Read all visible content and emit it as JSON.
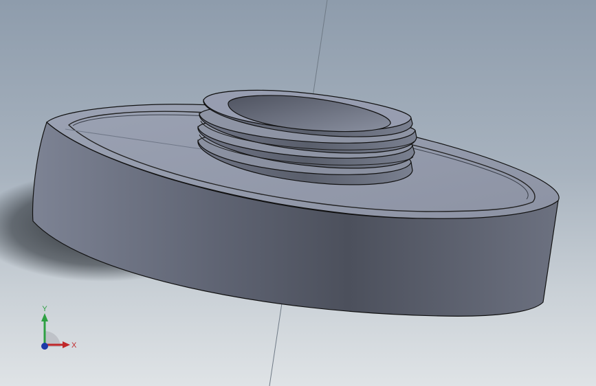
{
  "viewport": {
    "background_top": "#8e9cac",
    "background_bottom": "#dfe3e6"
  },
  "model": {
    "description_icon": "threaded-flange-part",
    "body_color": "#7c8293"
  },
  "triad": {
    "x_label": "X",
    "y_label": "Y",
    "x_color": "#c0282a",
    "y_color": "#2ea043",
    "z_color": "#1c3aa8"
  }
}
